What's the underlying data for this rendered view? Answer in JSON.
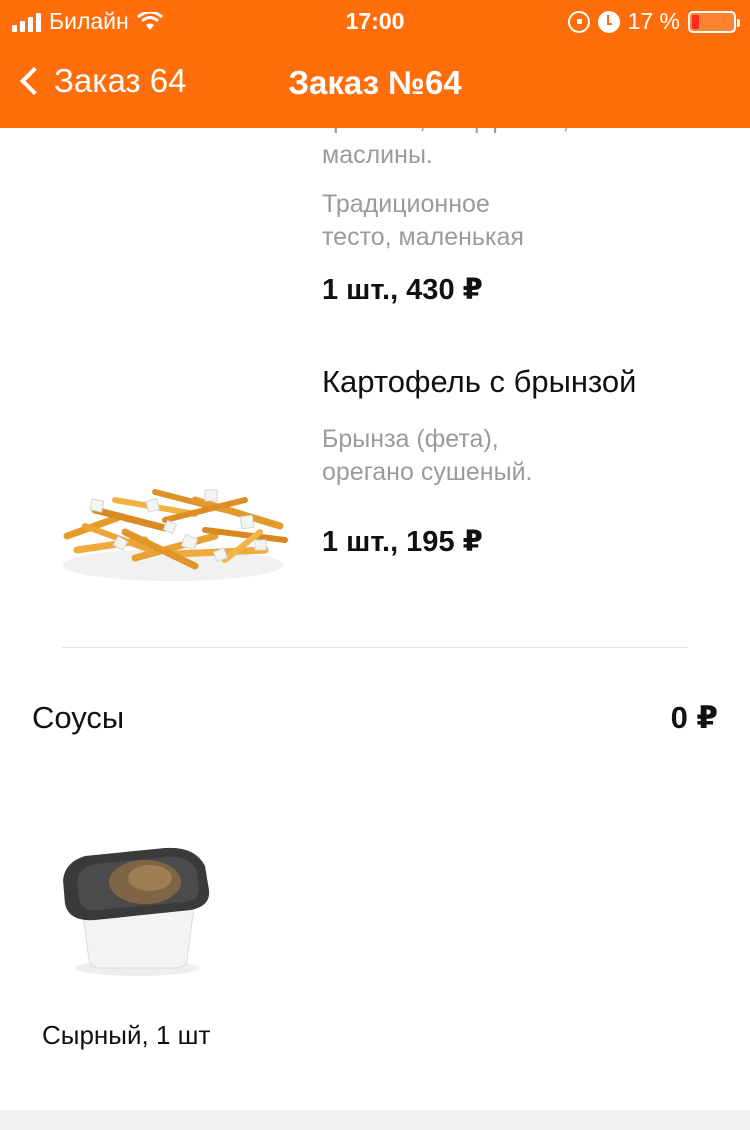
{
  "status_bar": {
    "carrier": "Билайн",
    "time": "17:00",
    "battery_percent": "17 %"
  },
  "nav": {
    "back_label": "Заказ 64",
    "title": "Заказ №64"
  },
  "items": [
    {
      "cut_text": "красный, моцарелла,",
      "description_lines": [
        "маслины.",
        "Традиционное",
        "тесто, маленькая"
      ],
      "quantity_price": "1 шт., 430 ₽"
    },
    {
      "name": "Картофель с брынзой",
      "description_lines": [
        "Брынза (фета),",
        "орегано сушеный."
      ],
      "quantity_price": "1 шт., 195 ₽",
      "image": "fries-with-feta-photo"
    }
  ],
  "sauces": {
    "title": "Соусы",
    "total": "0 ₽",
    "items": [
      {
        "label": "Сырный, 1 шт",
        "image": "cheese-sauce-cup-photo"
      }
    ]
  },
  "colors": {
    "accent": "#ff6e0a",
    "muted_text": "#9b9b9b"
  }
}
